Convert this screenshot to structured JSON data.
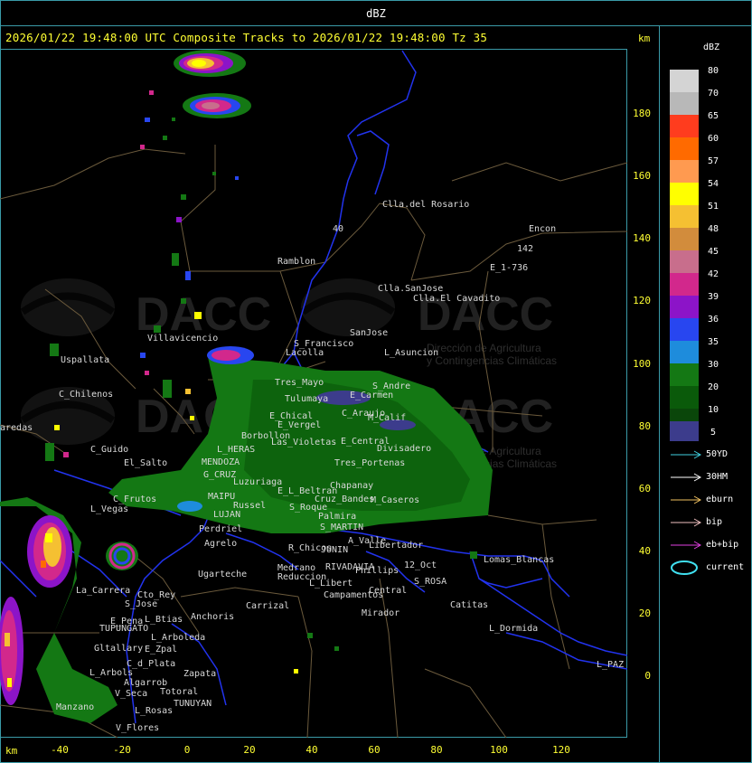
{
  "window_title": "dBZ",
  "info_line": "2026/01/22 19:48:00 UTC Composite Tracks to 2026/01/22 19:48:00 Tz 35",
  "km_label": "km",
  "y_ticks": [
    "180",
    "160",
    "140",
    "120",
    "100",
    "80",
    "60",
    "40",
    "20",
    "0"
  ],
  "x_ticks": [
    "-40",
    "-20",
    "0",
    "20",
    "40",
    "60",
    "80",
    "100",
    "120"
  ],
  "watermark": {
    "logo_text": "DACC",
    "line1": "Dirección de Agricultura",
    "line2": "y Contingencias Climáticas"
  },
  "legend": {
    "title": "dBZ",
    "scale": [
      {
        "value": "80",
        "color": "#d4d4d4"
      },
      {
        "value": "70",
        "color": "#b8b8b8"
      },
      {
        "value": "65",
        "color": "#ff3c1e"
      },
      {
        "value": "60",
        "color": "#ff6a00"
      },
      {
        "value": "57",
        "color": "#ff9a50"
      },
      {
        "value": "54",
        "color": "#ffff00"
      },
      {
        "value": "51",
        "color": "#f5c032"
      },
      {
        "value": "48",
        "color": "#d28c3c"
      },
      {
        "value": "45",
        "color": "#c86e8c"
      },
      {
        "value": "42",
        "color": "#d2288c"
      },
      {
        "value": "39",
        "color": "#8c14c8"
      },
      {
        "value": "36",
        "color": "#2846f0"
      },
      {
        "value": "35",
        "color": "#1e8cdc"
      },
      {
        "value": "30",
        "color": "#147814"
      },
      {
        "value": "20",
        "color": "#0a5a0a"
      },
      {
        "value": "10",
        "color": "#0a460a"
      },
      {
        "value": "5",
        "color": "#3c3c8c"
      }
    ],
    "tracks": [
      {
        "label": "50YD",
        "color": "#40d0e0"
      },
      {
        "label": "30HM",
        "color": "#ffffff"
      },
      {
        "label": "eburn",
        "color": "#f0c060"
      },
      {
        "label": "bip",
        "color": "#f0c0c0"
      },
      {
        "label": "eb+bip",
        "color": "#e040e0"
      },
      {
        "label": "current",
        "color": "#40e0f0"
      }
    ]
  },
  "places": [
    {
      "name": "Clla.del Rosario"
    },
    {
      "name": "Encon"
    },
    {
      "name": "142"
    },
    {
      "name": "E_1-736"
    },
    {
      "name": "Ramblon"
    },
    {
      "name": "40"
    },
    {
      "name": "Clla.SanJose"
    },
    {
      "name": "Clla.El Cavadito"
    },
    {
      "name": "SanJose"
    },
    {
      "name": "S_Francisco"
    },
    {
      "name": "L_Asuncion"
    },
    {
      "name": "Villavicencio"
    },
    {
      "name": "Uspallata"
    },
    {
      "name": "C_Chilenos"
    },
    {
      "name": "Tres_Mayo"
    },
    {
      "name": "Lacolla"
    },
    {
      "name": "S_Andre"
    },
    {
      "name": "E_Carmen"
    },
    {
      "name": "Tulumaya"
    },
    {
      "name": "E_Chical"
    },
    {
      "name": "E_Vergel"
    },
    {
      "name": "C_Araujo"
    },
    {
      "name": "M_Calif"
    },
    {
      "name": "aredas"
    },
    {
      "name": "Borbollon"
    },
    {
      "name": "Las_Violetas"
    },
    {
      "name": "E_Central"
    },
    {
      "name": "Divisadero"
    },
    {
      "name": "C_Guido"
    },
    {
      "name": "L_HERAS"
    },
    {
      "name": "El_Salto"
    },
    {
      "name": "MENDOZA"
    },
    {
      "name": "G_CRUZ"
    },
    {
      "name": "Luzuriaga"
    },
    {
      "name": "Tres_Portenas"
    },
    {
      "name": "Chapanay"
    },
    {
      "name": "E_L_Beltran"
    },
    {
      "name": "C_Frutos"
    },
    {
      "name": "MAIPU"
    },
    {
      "name": "Russel"
    },
    {
      "name": "Cruz_Bandes"
    },
    {
      "name": "M_Caseros"
    },
    {
      "name": "L_Vegas"
    },
    {
      "name": "LUJAN"
    },
    {
      "name": "S_Roque"
    },
    {
      "name": "Palmira"
    },
    {
      "name": "Perdriel"
    },
    {
      "name": "S_MARTIN"
    },
    {
      "name": "Agrelo"
    },
    {
      "name": "A_Valle"
    },
    {
      "name": "Libertador"
    },
    {
      "name": "R_Chicos"
    },
    {
      "name": "JUNIN"
    },
    {
      "name": "Medrano"
    },
    {
      "name": "RIVADAVIA"
    },
    {
      "name": "Phillips"
    },
    {
      "name": "12_Oct"
    },
    {
      "name": "Reduccion"
    },
    {
      "name": "L_Libert"
    },
    {
      "name": "S_ROSA"
    },
    {
      "name": "Lomas_Blancas"
    },
    {
      "name": "Ugarteche"
    },
    {
      "name": "La_Carrera"
    },
    {
      "name": "Cto_Rey"
    },
    {
      "name": "S_Jose"
    },
    {
      "name": "Campamentos"
    },
    {
      "name": "Central"
    },
    {
      "name": "Catitas"
    },
    {
      "name": "E_Pena"
    },
    {
      "name": "L_Btias"
    },
    {
      "name": "Anchoris"
    },
    {
      "name": "Carrizal"
    },
    {
      "name": "Mirador"
    },
    {
      "name": "TUPUNGATO"
    },
    {
      "name": "L_Arboleda"
    },
    {
      "name": "L_Dormida"
    },
    {
      "name": "Gltallary"
    },
    {
      "name": "E_Zpal"
    },
    {
      "name": "C_d_Plata"
    },
    {
      "name": "L_Arbols"
    },
    {
      "name": "Zapata"
    },
    {
      "name": "L_PAZ"
    },
    {
      "name": "V_Seca"
    },
    {
      "name": "Totoral"
    },
    {
      "name": "TUNUYAN"
    },
    {
      "name": "Manzano"
    },
    {
      "name": "L_Rosas"
    },
    {
      "name": "V_Flores"
    },
    {
      "name": "Algarrob"
    }
  ]
}
